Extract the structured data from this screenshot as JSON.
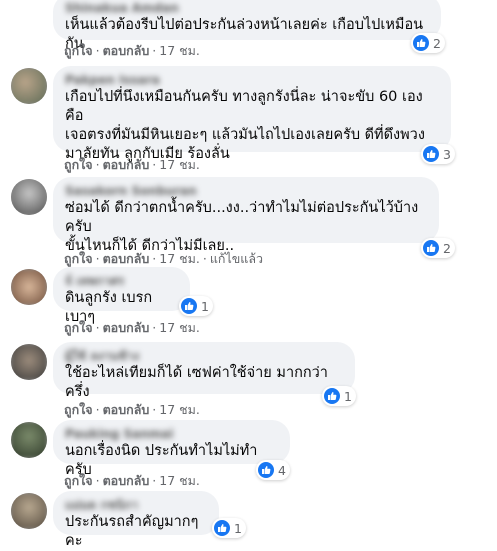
{
  "labels": {
    "like": "ถูกใจ",
    "reply": "ตอบกลับ",
    "edited": "แก้ไขแล้ว",
    "dot": "·"
  },
  "icons": {
    "reaction": "like-icon"
  },
  "colors": {
    "bubble": "#f0f2f5",
    "like": "#1877f2",
    "meta": "#65676b"
  },
  "comments": [
    {
      "name": "Shinakua Amdan",
      "text": "เห็นแล้วต้องรีบไปต่อประกันล่วงหน้าเลยค่ะ เกือบไปเหมือนกัน",
      "time": "17 ชม.",
      "likes": "2"
    },
    {
      "name": "Pakpen Issara",
      "text": "เกือบไปที่นึงเหมือนกันครับ ทางลูกรังนี่ละ น่าจะขับ 60 เอง คือ\nเจอตรงที่มันมีหินเยอะๆ แล้วมันไถไปเองเลยครับ ดีที่ดึงพวง\nมาลัยทัน ลูกกับเมีย ร้องลั่น",
      "time": "17 ชม.",
      "likes": "3"
    },
    {
      "name": "Sasakorn Sonburan",
      "text": "ซ่อมได้ ดีกว่าตกน้ำครับ...งง..ว่าทำไมไม่ต่อประกันไว้บ้างครับ\nขั้นไหนก็ได้ ดีกว่าไม่มีเลย..",
      "time": "17 ชม.",
      "edited": true,
      "likes": "2"
    },
    {
      "name": "จ์ เทพกาศร",
      "text": "ดินลูกรัง เบรกเบาๆ",
      "time": "17 ชม.",
      "likes": "1"
    },
    {
      "name": "ผู้ใช้ ลงานช้าง",
      "text": "ใช้อะไหล่เทียมก็ได้ เซฟค่าใช้จ่าย มากกว่าครึ่ง",
      "time": "17 ชม.",
      "likes": "1"
    },
    {
      "name": "Pauking Sanmai",
      "text": "นอกเรื่องนิด ประกันทำไมไม่ทำครับ",
      "time": "17 ชม.",
      "likes": "4"
    },
    {
      "name": "แม่มด กชนิกา",
      "text": "ประกันรถสำคัญมากๆคะ",
      "time": "",
      "likes": "1"
    }
  ]
}
